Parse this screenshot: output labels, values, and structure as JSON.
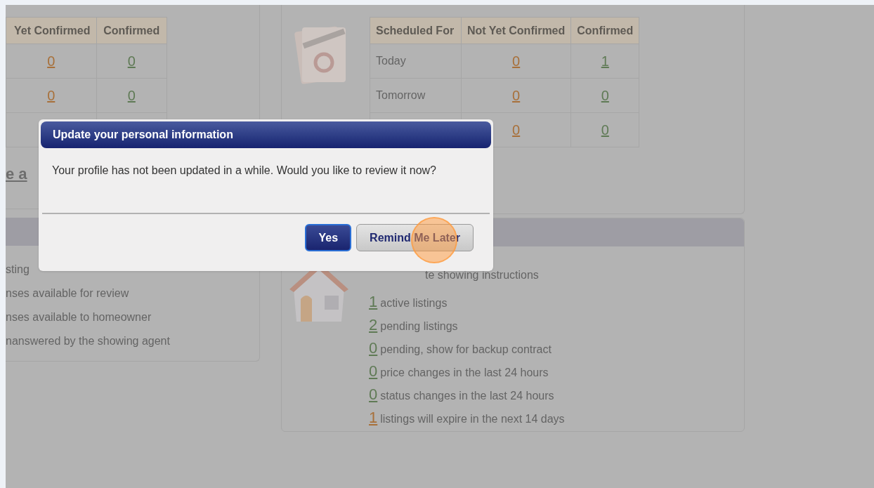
{
  "left_panel": {
    "appointments_table": {
      "columns": [
        "Yet Confirmed",
        "Confirmed"
      ],
      "rows": [
        [
          "0",
          "0"
        ],
        [
          "0",
          "0"
        ],
        [
          "",
          ""
        ]
      ]
    },
    "link": "e a"
  },
  "feedback_panel": {
    "items": [
      "sting",
      "nses available for review",
      "nses available to homeowner",
      "nanswered by the showing agent"
    ]
  },
  "schedule_panel": {
    "table": {
      "columns": [
        "Scheduled For",
        "Not Yet Confirmed",
        "Confirmed"
      ],
      "rows": [
        [
          "Today",
          "0",
          "1"
        ],
        [
          "Tomorrow",
          "0",
          "0"
        ],
        [
          "",
          "0",
          "0"
        ]
      ]
    }
  },
  "listings_panel": {
    "items": [
      {
        "text": "te showing instructions"
      },
      {
        "count": "1",
        "text": "active listings",
        "color": "#5f7a55"
      },
      {
        "count": "2",
        "text": "pending listings",
        "color": "#5f7a55"
      },
      {
        "count": "0",
        "text": "pending, show for backup contract",
        "color": "#5f7a55"
      },
      {
        "count": "0",
        "text": "price changes in the last 24 hours",
        "color": "#5f7a55"
      },
      {
        "count": "0",
        "text": "status changes in the last 24 hours",
        "color": "#5f7a55"
      },
      {
        "count": "1",
        "text": "listings will expire in the next 14 days",
        "color": "#a8703a"
      }
    ]
  },
  "dialog": {
    "title": "Update your personal information",
    "message": "Your profile has not been updated in a while. Would you like to review it now?",
    "buttons": [
      {
        "label": "Yes",
        "kind": "primary"
      },
      {
        "label": "Remind Me Later",
        "kind": "secondary"
      }
    ]
  }
}
